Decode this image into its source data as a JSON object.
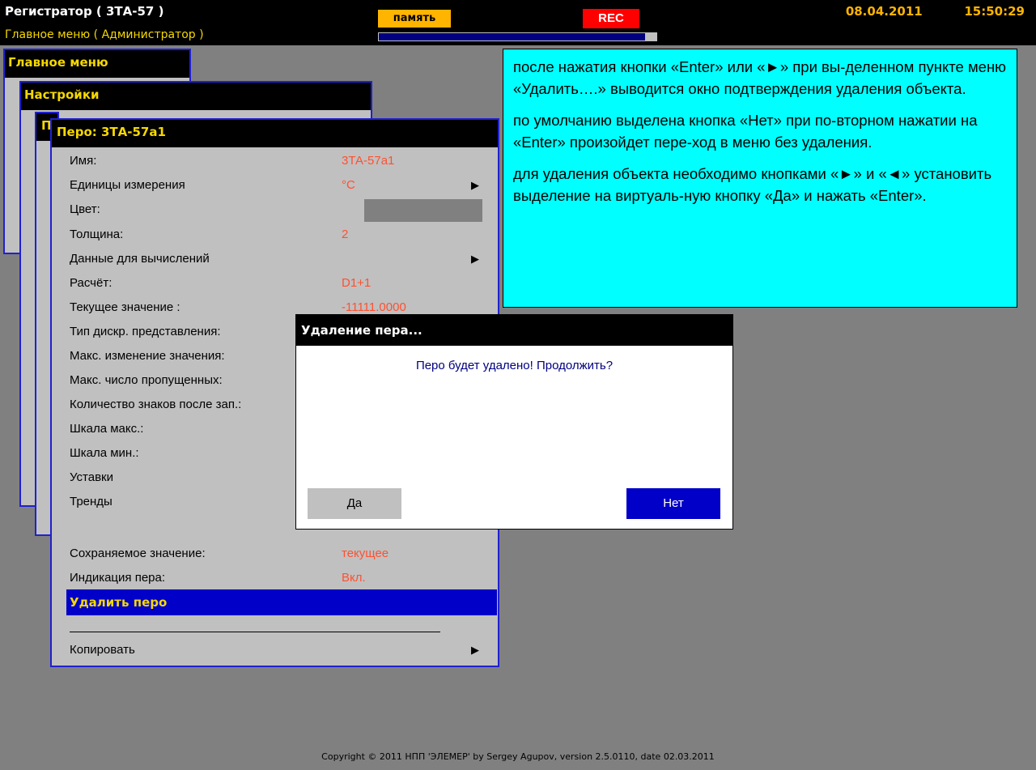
{
  "header": {
    "device_title": "Регистратор ( 3ТА-57 )",
    "menu_path": "Главное меню ( Администратор )",
    "memory_label": "память",
    "memory_fill": 0.96,
    "rec_label": "REC",
    "datetime": "08.04.2011   15:50:29"
  },
  "windows": {
    "main_title": "Главное меню",
    "settings_title": "Настройки",
    "third_title": "П"
  },
  "pen": {
    "title": "Перо: 3ТА-57а1",
    "rows": [
      {
        "label": "Имя:",
        "value": "3ТА-57а1"
      },
      {
        "label": "Единицы измерения",
        "value": "°C"
      },
      {
        "label": "Цвет:",
        "value": ""
      },
      {
        "label": "Толщина:",
        "value": "2"
      },
      {
        "label": "Данные для вычислений",
        "value": ""
      },
      {
        "label": "Расчёт:",
        "value": "D1+1"
      },
      {
        "label": "Текущее значение :",
        "value": "-11111.0000"
      },
      {
        "label": "Тип дискр. представления:",
        "value": ""
      },
      {
        "label": "Макс. изменение значения:",
        "value": ""
      },
      {
        "label": "Макс. число пропущенных:",
        "value": ""
      },
      {
        "label": "Количество знаков после зап.:",
        "value": ""
      },
      {
        "label": "Шкала макс.:",
        "value": ""
      },
      {
        "label": "Шкала мин.:",
        "value": ""
      },
      {
        "label": "Уставки",
        "value": ""
      },
      {
        "label": "Тренды",
        "value": ""
      },
      {
        "label": "Сохраняемое значение:",
        "value": "текущее"
      },
      {
        "label": "Индикация пера:",
        "value": "Вкл."
      }
    ],
    "delete_label": "Удалить перо",
    "copy_label": "Копировать",
    "swatch_color": "#808080"
  },
  "dialog": {
    "title": "Удаление пера...",
    "message": "Перо будет удалено! Продолжить?",
    "yes_label": "Да",
    "no_label": "Нет"
  },
  "note": {
    "p1": "после нажатия кнопки «Enter» или «►» при вы-деленном пункте меню «Удалить….» выводится окно подтверждения удаления объекта.",
    "p2": "по умолчанию выделена кнопка «Нет» при по-вторном нажатии на «Enter» произойдет пере-ход в меню без удаления.",
    "p3": "для удаления объекта необходимо кнопками «►» и «◄» установить выделение на виртуаль-ную кнопку «Да» и нажать «Enter»."
  },
  "footer": {
    "copyright": "Copyright © 2011 НПП 'ЭЛЕМЕР' by Sergey Agupov, version 2.5.0110, date 02.03.2011"
  },
  "colors": {
    "menu_highlight": "#0000c8",
    "title_text": "#f5d800",
    "value_text": "#ff5030",
    "note_bg": "#00ffff"
  },
  "icons": {
    "submenu_arrow": "triangle-right-icon"
  }
}
